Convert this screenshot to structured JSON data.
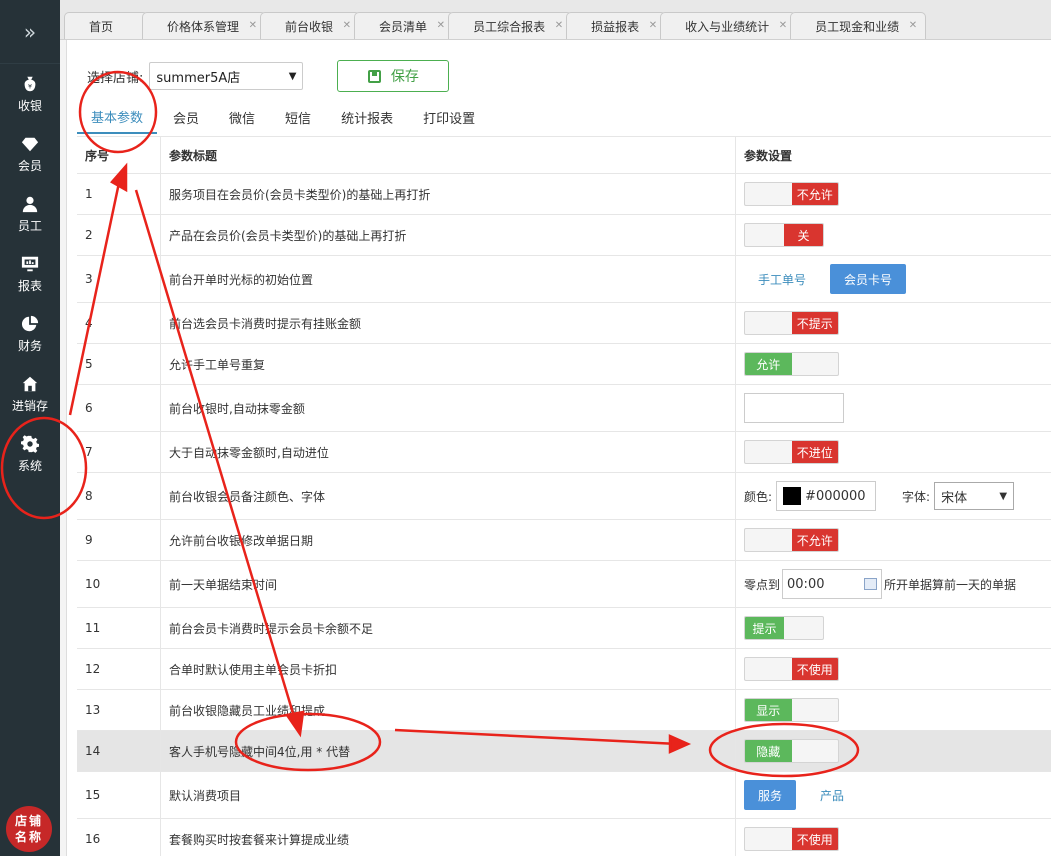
{
  "sidebar": {
    "items": [
      {
        "label": "收银",
        "icon": "money-bag-icon"
      },
      {
        "label": "会员",
        "icon": "diamond-icon"
      },
      {
        "label": "员工",
        "icon": "user-icon"
      },
      {
        "label": "报表",
        "icon": "monitor-chart-icon"
      },
      {
        "label": "财务",
        "icon": "pie-chart-icon"
      },
      {
        "label": "进销存",
        "icon": "home-icon"
      },
      {
        "label": "系统",
        "icon": "gear-icon"
      }
    ],
    "store_badge": "店铺名称"
  },
  "tabs": [
    "首页",
    "价格体系管理",
    "前台收银",
    "会员清单",
    "员工综合报表",
    "损益报表",
    "收入与业绩统计",
    "员工现金和业绩"
  ],
  "toolbar": {
    "store_label": "选择店铺:",
    "store_value": "summer5A店",
    "save_label": "保存"
  },
  "subtabs": [
    "基本参数",
    "会员",
    "微信",
    "短信",
    "统计报表",
    "打印设置"
  ],
  "table": {
    "headers": [
      "序号",
      "参数标题",
      "参数设置"
    ],
    "rows": [
      {
        "no": "1",
        "title": "服务项目在会员价(会员卡类型价)的基础上再打折",
        "value": "不允许"
      },
      {
        "no": "2",
        "title": "产品在会员价(会员卡类型价)的基础上再打折",
        "value": "关"
      },
      {
        "no": "3",
        "title": "前台开单时光标的初始位置",
        "opt1": "手工单号",
        "opt2": "会员卡号"
      },
      {
        "no": "4",
        "title": "前台选会员卡消费时提示有挂账金额",
        "value": "不提示"
      },
      {
        "no": "5",
        "title": "允许手工单号重复",
        "value": "允许"
      },
      {
        "no": "6",
        "title": "前台收银时,自动抹零金额"
      },
      {
        "no": "7",
        "title": "大于自动抹零金额时,自动进位",
        "value": "不进位"
      },
      {
        "no": "8",
        "title": "前台收银会员备注颜色、字体",
        "color_label": "颜色:",
        "color_value": "#000000",
        "font_label": "字体:",
        "font_value": "宋体"
      },
      {
        "no": "9",
        "title": "允许前台收银修改单据日期",
        "value": "不允许"
      },
      {
        "no": "10",
        "title": "前一天单据结束时间",
        "prefix": "零点到",
        "time": "00:00",
        "suffix": "所开单据算前一天的单据"
      },
      {
        "no": "11",
        "title": "前台会员卡消费时提示会员卡余额不足",
        "value": "提示"
      },
      {
        "no": "12",
        "title": "合单时默认使用主单会员卡折扣",
        "value": "不使用"
      },
      {
        "no": "13",
        "title": "前台收银隐藏员工业绩和提成",
        "value": "显示"
      },
      {
        "no": "14",
        "title": "客人手机号隐藏中间4位,用 * 代替",
        "value": "隐藏"
      },
      {
        "no": "15",
        "title": "默认消费项目",
        "opt1": "服务",
        "opt2": "产品"
      },
      {
        "no": "16",
        "title": "套餐购买时按套餐来计算提成业绩",
        "value": "不使用"
      }
    ]
  },
  "colors": {
    "sidebar": "#263238",
    "accent": "#3c8dbc",
    "danger": "#d9352f",
    "success": "#5cb85c",
    "annotation": "#e8231b"
  }
}
